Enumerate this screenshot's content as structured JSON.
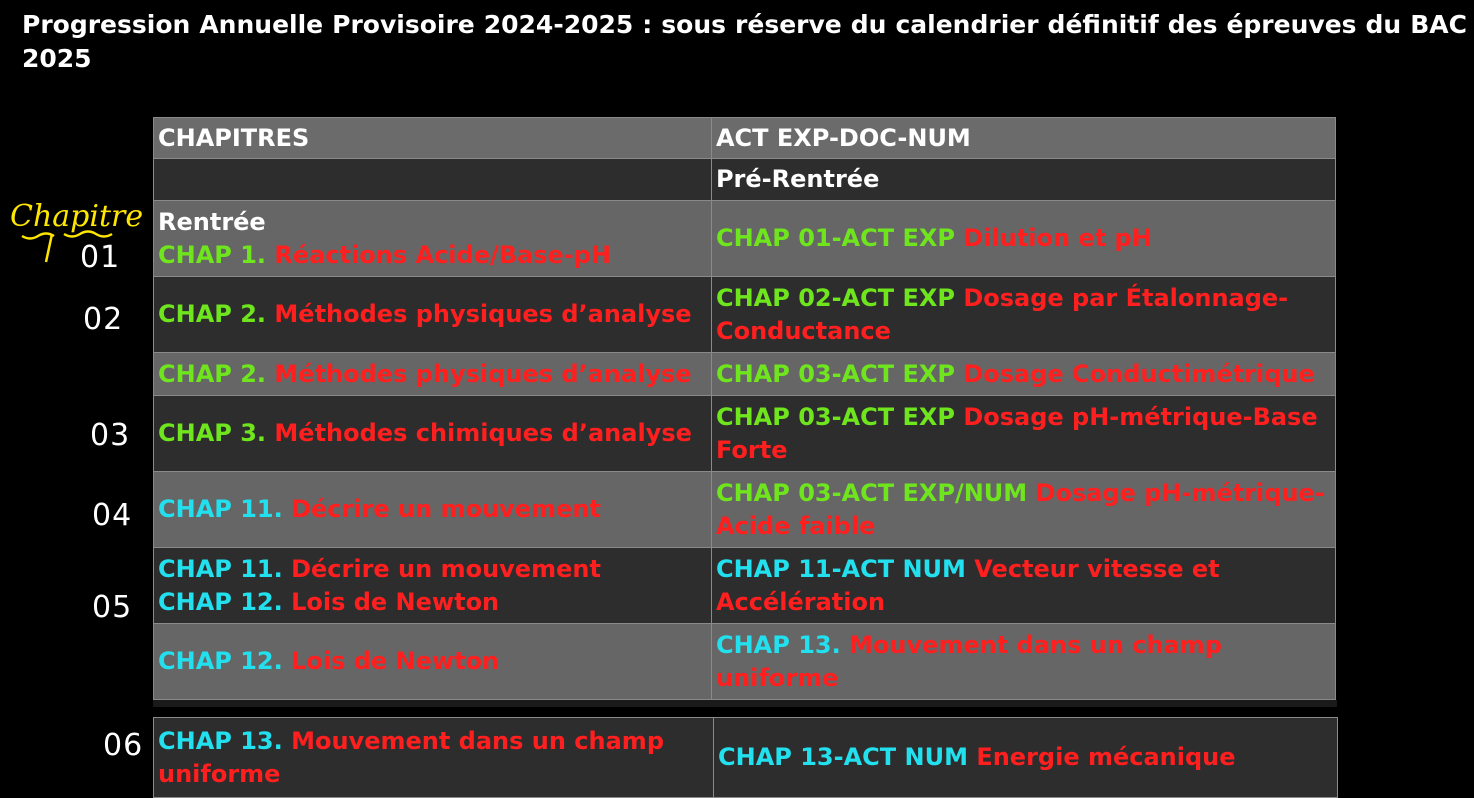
{
  "title": "Progression Annuelle Provisoire 2024-2025 : sous réserve du calendrier définitif des épreuves du BAC 2025",
  "header": {
    "col1": "CHAPITRES",
    "col2": "ACT EXP-DOC-NUM"
  },
  "annotations": {
    "chapitre": "Chapitre",
    "n01": "01",
    "n02": "02",
    "n03": "03",
    "n04": "04",
    "n05": "05",
    "n06": "06"
  },
  "rows": [
    {
      "c1": [],
      "c2": {
        "pre": "Pré-Rentrée"
      }
    },
    {
      "c1": {
        "rentree": "Rentrée",
        "tag": "CHAP 1.",
        "text": "Réactions Acide/Base-pH"
      },
      "c2": {
        "tag": "CHAP 01-ACT EXP",
        "text": "Dilution et pH"
      }
    },
    {
      "c1": {
        "tag": "CHAP 2.",
        "text": "Méthodes physiques d’analyse"
      },
      "c2": {
        "tag": "CHAP 02-ACT EXP",
        "text": "Dosage par Étalonnage-Conductance"
      }
    },
    {
      "c1": {
        "tag": "CHAP 2.",
        "text": "Méthodes physiques d’analyse"
      },
      "c2": {
        "tag": "CHAP 03-ACT EXP",
        "text": "Dosage Conductimétrique"
      }
    },
    {
      "c1": {
        "tag": "CHAP 3.",
        "text": "Méthodes chimiques d’analyse"
      },
      "c2": {
        "tag": "CHAP 03-ACT EXP",
        "text": "Dosage pH-métrique-Base Forte"
      }
    },
    {
      "c1": {
        "tag": "CHAP 11.",
        "text": "Décrire un mouvement"
      },
      "c2": {
        "tag": "CHAP 03-ACT EXP/NUM",
        "text": "Dosage pH-métrique-Acide faible"
      }
    },
    {
      "c1": {
        "tag": "CHAP 11.",
        "text": "Décrire un mouvement",
        "tag2": "CHAP 12.",
        "text2": "Lois de Newton"
      },
      "c2": {
        "tag": "CHAP 11-ACT NUM",
        "text": "Vecteur vitesse et Accélération"
      }
    },
    {
      "c1": {
        "tag": "CHAP 12.",
        "text": "Lois de Newton"
      },
      "c2": {
        "tag": "CHAP 13.",
        "text": "Mouvement dans un champ uniforme"
      }
    },
    {
      "c1": {
        "tag": "CHAP 13.",
        "text": "Mouvement dans un champ uniforme"
      },
      "c2": {
        "tag": "CHAP 13-ACT NUM",
        "text": "Energie mécanique"
      }
    }
  ],
  "colors": {
    "green": "#6fe51d",
    "cyan": "#22e0ee",
    "red": "#ff1f1f"
  }
}
